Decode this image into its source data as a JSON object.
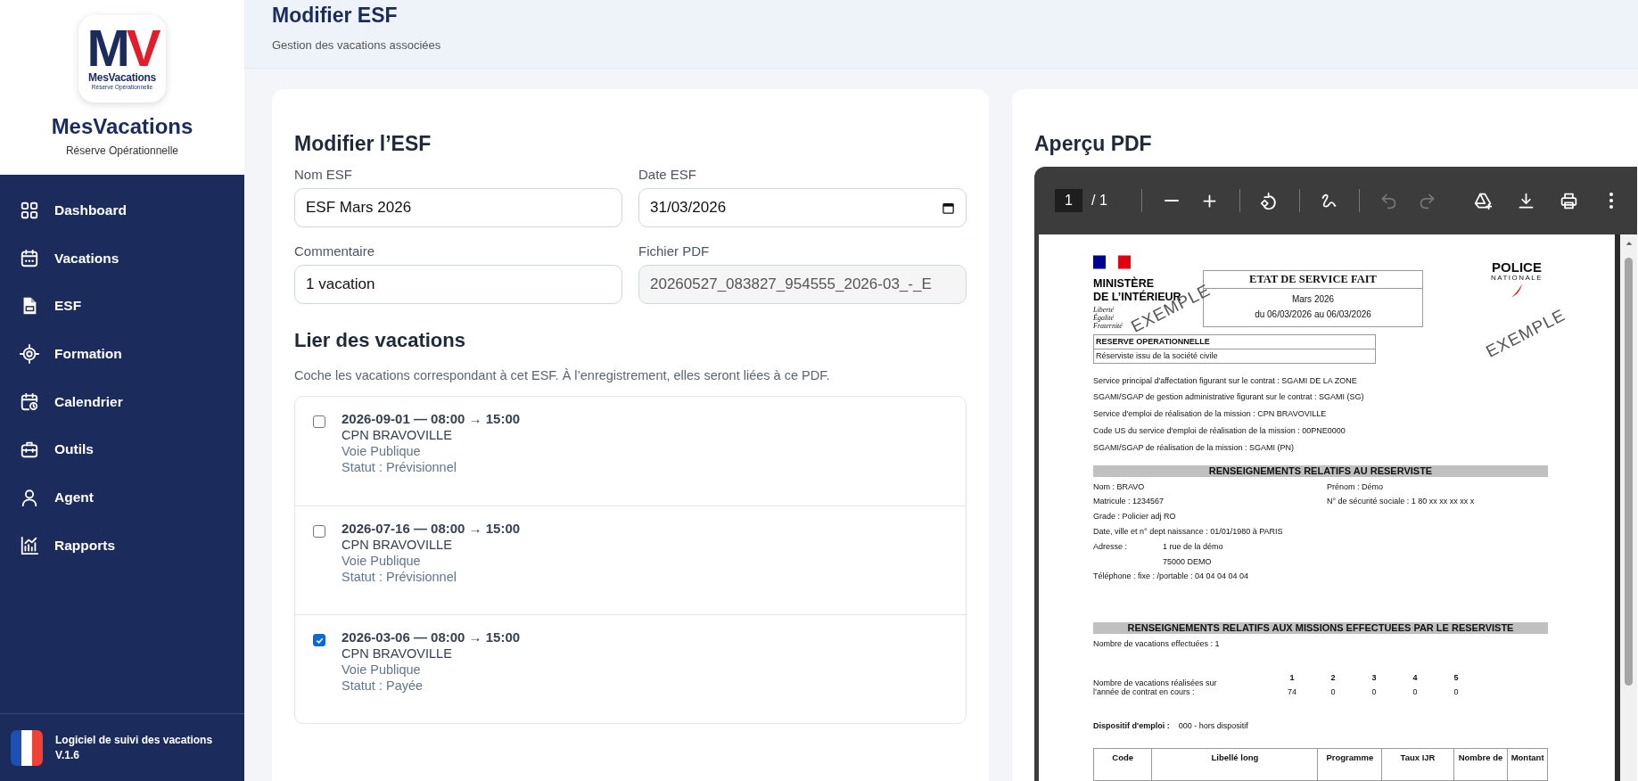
{
  "sidebar": {
    "logo": {
      "mark_left": "M",
      "mark_right": "V",
      "name": "MesVacations",
      "tagline": "Réserve Opérationnelle"
    },
    "app_name": "MesVacations",
    "app_subtitle": "Réserve Opérationnelle",
    "items": [
      {
        "kind": "dashboard",
        "label": "Dashboard"
      },
      {
        "kind": "vacations",
        "label": "Vacations"
      },
      {
        "kind": "esf",
        "label": "ESF"
      },
      {
        "kind": "formation",
        "label": "Formation"
      },
      {
        "kind": "calendrier",
        "label": "Calendrier"
      },
      {
        "kind": "outils",
        "label": "Outils"
      },
      {
        "kind": "agent",
        "label": "Agent"
      },
      {
        "kind": "rapports",
        "label": "Rapports"
      }
    ],
    "footer": {
      "title": "Logiciel de suivi des vacations",
      "version": "V.1.6"
    }
  },
  "header": {
    "title": "Modifier ESF",
    "subtitle": "Gestion des vacations associées"
  },
  "form": {
    "title": "Modifier l’ESF",
    "fields": [
      {
        "kind": "text",
        "label": "Nom ESF",
        "value": "ESF Mars 2026",
        "readonly": false
      },
      {
        "kind": "date",
        "label": "Date ESF",
        "value": "31/03/2026",
        "readonly": false
      },
      {
        "kind": "text",
        "label": "Commentaire",
        "value": "1 vacation",
        "readonly": false
      },
      {
        "kind": "text",
        "label": "Fichier PDF",
        "value": "20260527_083827_954555_2026-03_-_E",
        "readonly": true
      }
    ],
    "link_title": "Lier des vacations",
    "link_hint": "Coche les vacations correspondant à cet ESF. À l’enregistrement, elles seront liées à ce PDF.",
    "vacations": [
      {
        "title": "2026-09-01 — 08:00 → 15:00",
        "unit": "CPN BRAVOVILLE",
        "place": "Voie Publique",
        "status": "Statut : Prévisionnel",
        "checked": false
      },
      {
        "title": "2026-07-16 — 08:00 → 15:00",
        "unit": "CPN BRAVOVILLE",
        "place": "Voie Publique",
        "status": "Statut : Prévisionnel",
        "checked": false
      },
      {
        "title": "2026-03-06 — 08:00 → 15:00",
        "unit": "CPN BRAVOVILLE",
        "place": "Voie Publique",
        "status": "Statut : Payée",
        "checked": true
      }
    ]
  },
  "preview": {
    "title": "Aperçu PDF",
    "toolbar": {
      "page_current": "1",
      "page_total": "/ 1",
      "groups": [
        [
          {
            "kind": "zoom-out",
            "disabled": false
          },
          {
            "kind": "zoom-in",
            "disabled": false
          }
        ],
        [
          {
            "kind": "rotate",
            "disabled": false
          }
        ],
        [
          {
            "kind": "draw",
            "disabled": false
          }
        ],
        [
          {
            "kind": "undo",
            "disabled": true
          },
          {
            "kind": "redo",
            "disabled": true
          }
        ]
      ],
      "actions": [
        {
          "kind": "drive",
          "disabled": false
        },
        {
          "kind": "download",
          "disabled": false
        },
        {
          "kind": "print",
          "disabled": false
        },
        {
          "kind": "more",
          "disabled": false
        }
      ]
    },
    "document": {
      "ministry": [
        "MINISTÈRE",
        "DE L’INTÉRIEUR"
      ],
      "motto": [
        "Liberté",
        "Égalité",
        "Fraternité"
      ],
      "police": [
        "POLICE",
        "NATIONALE"
      ],
      "stamps": [
        "EXEMPLE",
        "EXEMPLE"
      ],
      "doc_title": "ETAT DE SERVICE FAIT",
      "period": "Mars 2026",
      "range": "du 06/03/2026 au 06/03/2026",
      "status_head": "RESERVE OPERATIONNELLE",
      "status_value": "Réserviste issu de la société civile",
      "service_lines": [
        "Service principal d'affectation figurant sur le contrat : SGAMI DE LA ZONE",
        "SGAMI/SGAP de gestion administrative figurant sur le contrat : SGAMI (SG)",
        "Service d'emploi de réalisation de la mission : CPN BRAVOVILLE",
        "Code US du service d'emploi de réalisation de la mission : 00PNE0000",
        "SGAMI/SGAP de réalisation de la mission : SGAMI (PN)"
      ],
      "section_reservist": "RENSEIGNEMENTS RELATIFS AU RESERVISTE",
      "identity_left": [
        "Nom : BRAVO",
        "Matricule : 1234567",
        "Grade : Policier adj RO",
        "Date, ville et n° dept naissance : 01/01/1980 à PARIS"
      ],
      "identity_right": [
        "Prénom : Démo",
        "N° de sécurité sociale : 1 80 xx xx xx xx x"
      ],
      "address_label": "Adresse :",
      "address_lines": [
        "1 rue de la démo",
        "75000 DEMO"
      ],
      "phone": "Téléphone : fixe :  /portable : 04 04 04 04 04",
      "section_missions": "RENSEIGNEMENTS RELATIFS AUX MISSIONS EFFECTUEES PAR LE RESERVISTE",
      "count": "Nombre de vacations effectuées : 1",
      "years_label": [
        "Nombre de vacations réalisées sur",
        "l’année de contrat en cours :"
      ],
      "years": [
        {
          "head": "1",
          "value": "74"
        },
        {
          "head": "2",
          "value": "0"
        },
        {
          "head": "3",
          "value": "0"
        },
        {
          "head": "4",
          "value": "0"
        },
        {
          "head": "5",
          "value": "0"
        }
      ],
      "dispositif_label": "Dispositif d'emploi :",
      "dispositif_value": "000 - hors dispositif",
      "table_columns": [
        "Code",
        "Libellé long",
        "Programme",
        "Taux IJR",
        "Nombre de",
        "Montant"
      ]
    }
  }
}
